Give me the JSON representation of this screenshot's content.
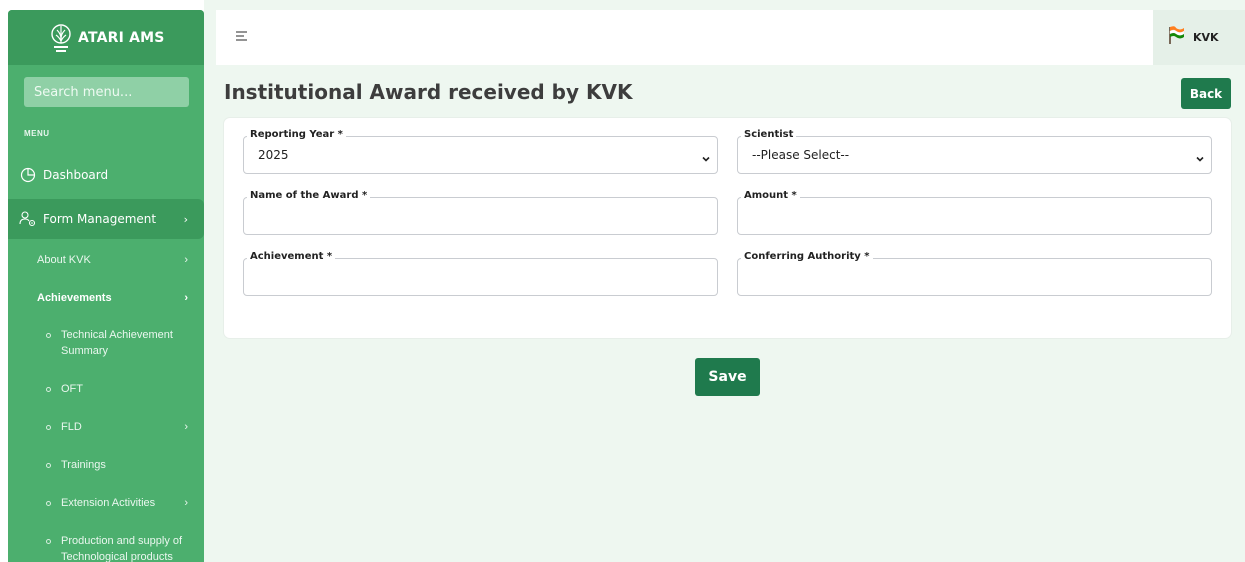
{
  "app": {
    "brand": "ATARI AMS"
  },
  "sidebar": {
    "search_placeholder": "Search menu...",
    "menu_heading": "MENU",
    "items": [
      {
        "label": "Dashboard"
      },
      {
        "label": "Form Management"
      }
    ],
    "sub_items": [
      {
        "label": "About KVK"
      },
      {
        "label": "Achievements"
      }
    ],
    "leaves": [
      {
        "label": "Technical Achievement Summary"
      },
      {
        "label": "OFT"
      },
      {
        "label": "FLD"
      },
      {
        "label": "Trainings"
      },
      {
        "label": "Extension Activities"
      },
      {
        "label": "Production and supply of Technological products"
      }
    ]
  },
  "topbar": {
    "user_label": "KVK"
  },
  "page": {
    "title": "Institutional Award received by KVK",
    "back_label": "Back",
    "save_label": "Save"
  },
  "form": {
    "reporting_year": {
      "label": "Reporting Year *",
      "value": "2025"
    },
    "scientist": {
      "label": "Scientist",
      "value": "--Please Select--"
    },
    "award_name": {
      "label": "Name of the Award *",
      "value": ""
    },
    "amount": {
      "label": "Amount *",
      "value": ""
    },
    "achievement": {
      "label": "Achievement *",
      "value": ""
    },
    "conferring_authority": {
      "label": "Conferring Authority *",
      "value": ""
    }
  },
  "colors": {
    "sidebar": "#4caf6e",
    "sidebar_dark": "#3b9a5c",
    "primary_button": "#1f7a4d",
    "content_bg": "#eef7f0"
  }
}
